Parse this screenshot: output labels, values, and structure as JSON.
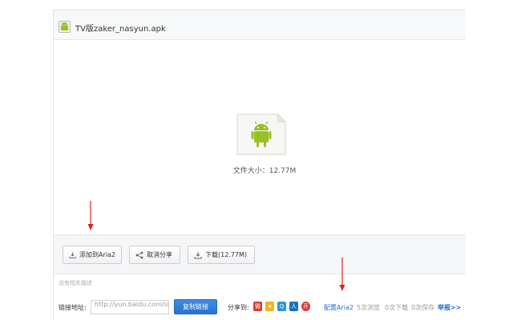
{
  "file": {
    "name": "TV版zaker_nasyun.apk",
    "size_text": "文件大小：12.77M"
  },
  "icons": {
    "file_type": "android-apk-icon",
    "add_aria2": "download-icon",
    "unshare": "share-icon",
    "download": "download-icon"
  },
  "toolbar": {
    "add_aria2_label": "添加到Aria2",
    "unshare_label": "取消分享",
    "download_label": "下载(12.77M)"
  },
  "description": "没有相关描述",
  "link": {
    "label": "链接地址:",
    "value": "http://yun.baidu.com/sl",
    "copy_label": "复制链接"
  },
  "share": {
    "label": "分享到:",
    "targets": [
      "weibo-icon",
      "qzone-icon",
      "tencent-weibo-icon",
      "renren-icon",
      "kaixin-icon"
    ]
  },
  "stats": {
    "aria_config": "配置Aria2",
    "views": "5次浏览",
    "downloads": "0次下载",
    "saves": "0次保存",
    "report": "举报>>"
  },
  "colors": {
    "accent": "#2a6ad0",
    "android_green": "#97c024",
    "annotation_red": "#e02020"
  }
}
